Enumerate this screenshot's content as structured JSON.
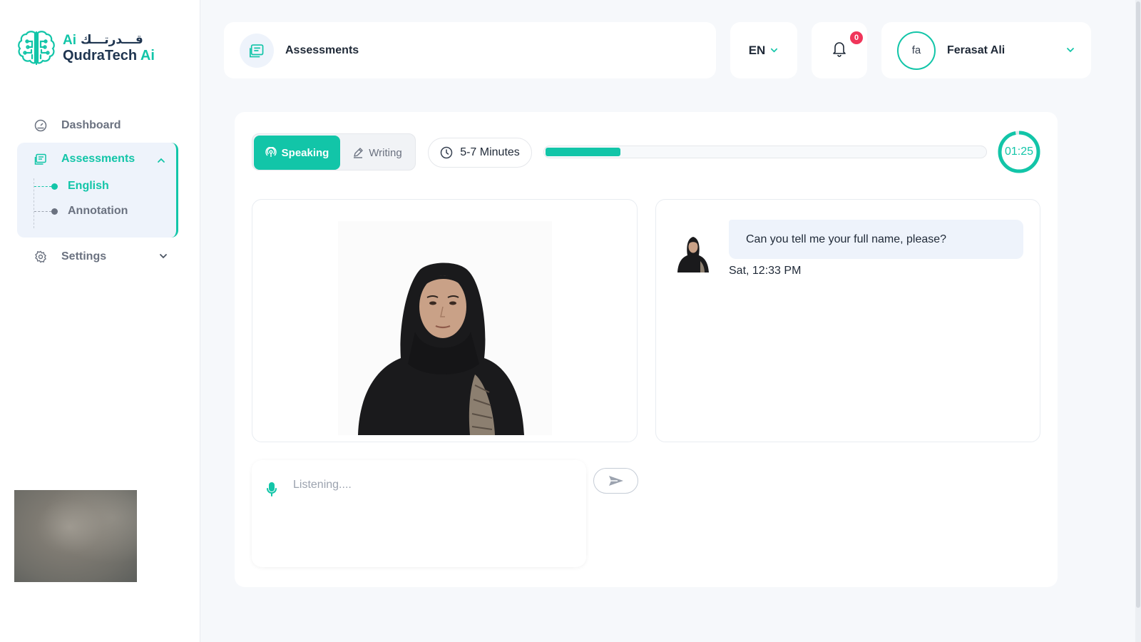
{
  "brand": {
    "arabic": "قـــدرتـــك",
    "ai_top": "Ai",
    "name": "QudraTech",
    "ai": "Ai",
    "accent_color": "#12c5a8"
  },
  "sidebar": {
    "items": [
      {
        "label": "Dashboard",
        "icon": "gauge-icon"
      },
      {
        "label": "Assessments",
        "icon": "assessment-icon",
        "expanded": true,
        "children": [
          {
            "label": "English",
            "active": true
          },
          {
            "label": "Annotation",
            "active": false
          }
        ]
      },
      {
        "label": "Settings",
        "icon": "gear-icon",
        "expanded": false
      }
    ]
  },
  "header": {
    "title": "Assessments",
    "language": "EN",
    "notification_count": "0",
    "user": {
      "initials": "fa",
      "name": "Ferasat Ali"
    }
  },
  "assessment": {
    "modes": {
      "speaking": "Speaking",
      "writing": "Writing",
      "active": "speaking"
    },
    "duration": "5-7 Minutes",
    "progress_fraction": 0.17,
    "timer": "01:25",
    "timer_fraction": 0.97
  },
  "chat": {
    "messages": [
      {
        "text": "Can you tell me your full name, please?",
        "time": "Sat, 12:33 PM",
        "sender": "ai-avatar"
      }
    ]
  },
  "input": {
    "placeholder": "Listening....",
    "value": ""
  }
}
